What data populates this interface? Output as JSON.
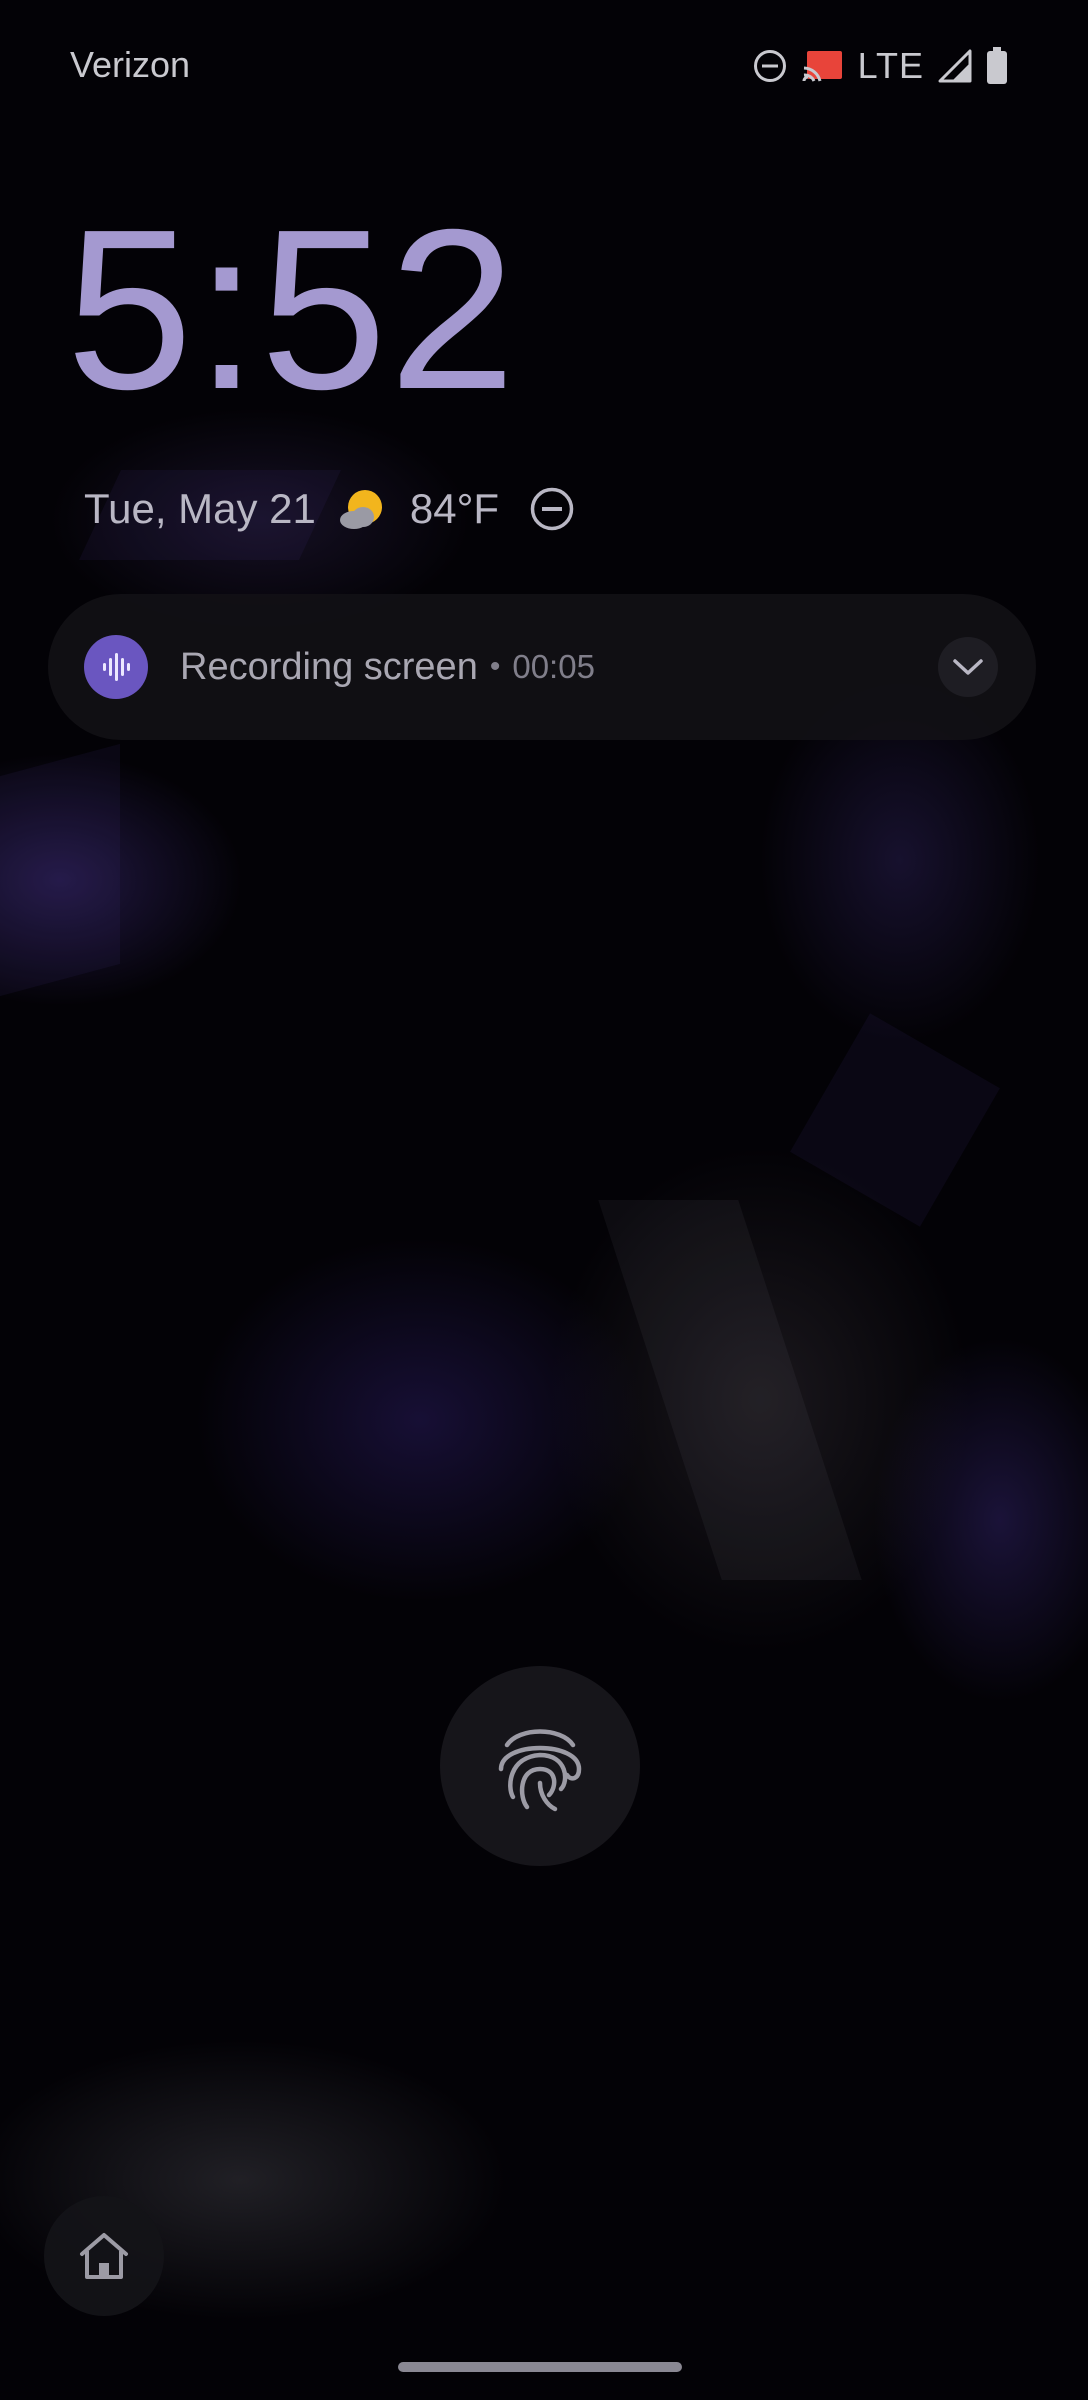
{
  "status_bar": {
    "carrier": "Verizon",
    "network": "LTE",
    "icons": [
      "do-not-disturb-icon",
      "cast-icon",
      "lte-label",
      "signal-icon",
      "battery-icon"
    ]
  },
  "lock_screen": {
    "time": "5:52",
    "date": "Tue, May 21",
    "weather_icon": "partly-cloudy-icon",
    "temperature": "84°F",
    "dnd_icon": "do-not-disturb-icon"
  },
  "notification": {
    "app_icon": "sound-waves-icon",
    "title": "Recording screen",
    "separator": "•",
    "elapsed": "00:05",
    "expand_icon": "chevron-down-icon"
  },
  "unlock": {
    "icon": "fingerprint-icon"
  },
  "shortcuts": {
    "left_icon": "home-icon"
  },
  "colors": {
    "clock": "#a499d0",
    "accent": "#6a56c0",
    "cast_red": "#e8443a",
    "weather_sun": "#f2b51d"
  }
}
